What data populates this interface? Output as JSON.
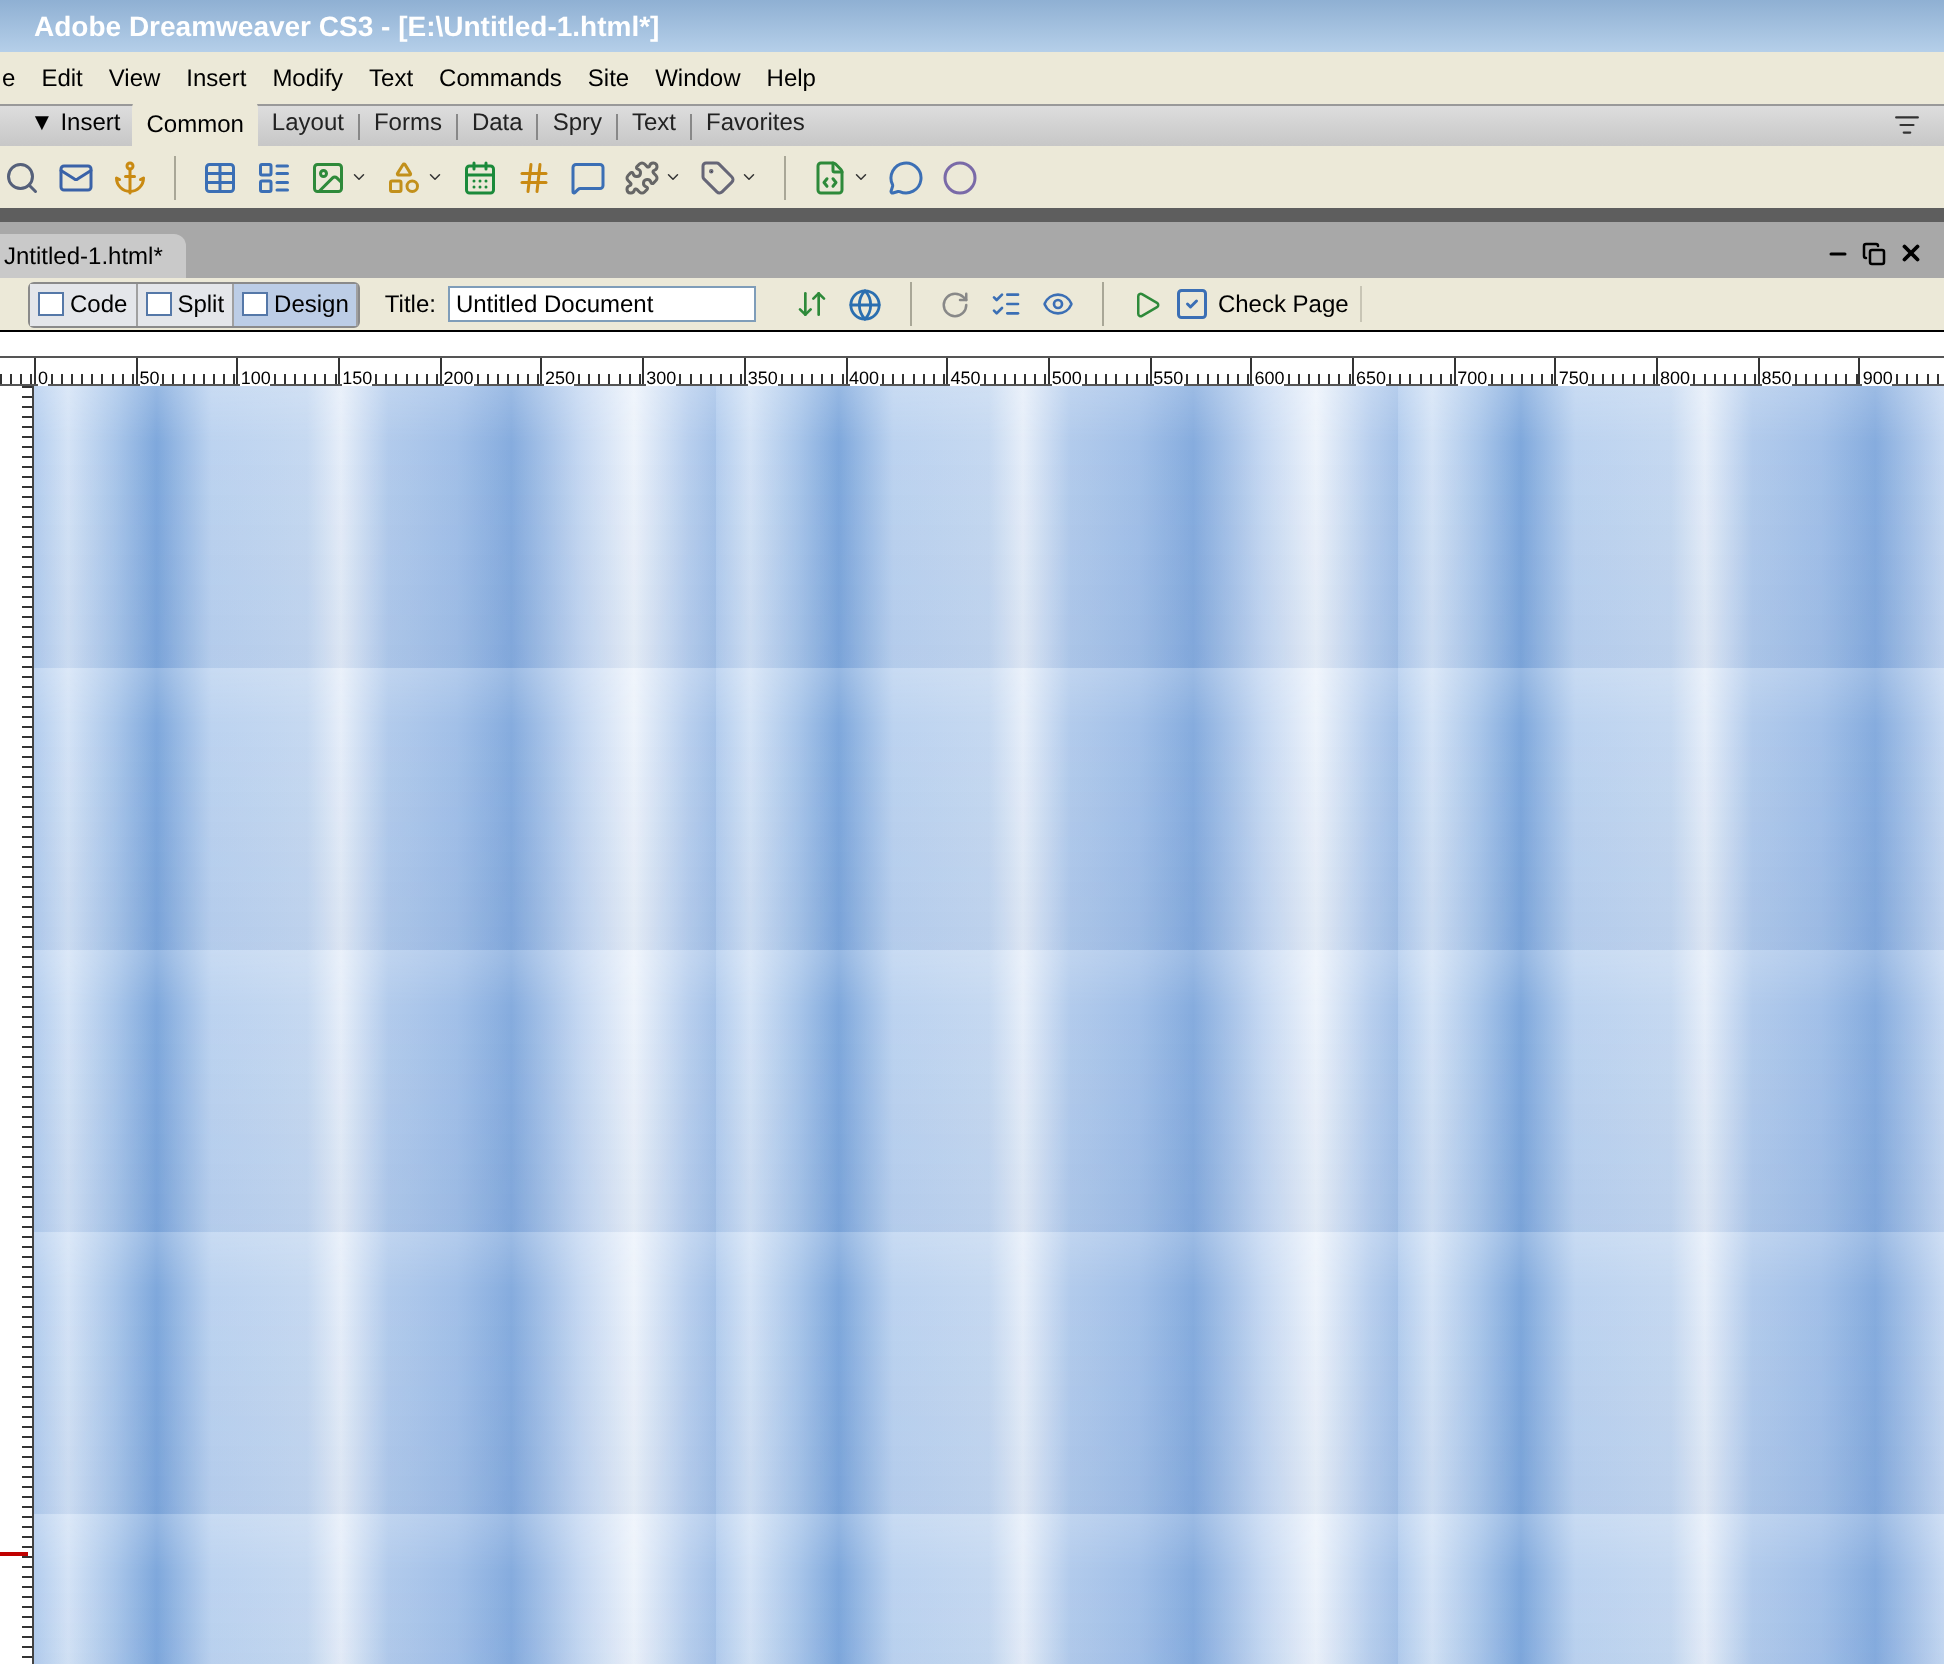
{
  "window": {
    "title": "Adobe Dreamweaver CS3 - [E:\\Untitled-1.html*]"
  },
  "menu": [
    "e",
    "Edit",
    "View",
    "Insert",
    "Modify",
    "Text",
    "Commands",
    "Site",
    "Window",
    "Help"
  ],
  "insert_bar": {
    "label": "▼ Insert",
    "tabs": [
      {
        "label": "Common",
        "selected": true
      },
      {
        "label": "Layout",
        "selected": false
      },
      {
        "label": "Forms",
        "selected": false
      },
      {
        "label": "Data",
        "selected": false
      },
      {
        "label": "Spry",
        "selected": false
      },
      {
        "label": "Text",
        "selected": false
      },
      {
        "label": "Favorites",
        "selected": false
      }
    ]
  },
  "document": {
    "tab_label": "Jntitled-1.html*",
    "view_buttons": [
      {
        "label": "Code",
        "selected": false
      },
      {
        "label": "Split",
        "selected": false
      },
      {
        "label": "Design",
        "selected": true
      }
    ],
    "title_label": "Title:",
    "title_value": "Untitled Document",
    "check_page": "Check Page"
  },
  "ruler": [
    "0",
    "50",
    "100",
    "150",
    "200",
    "250",
    "300",
    "350",
    "400",
    "450",
    "500",
    "550",
    "600",
    "650",
    "700",
    "750",
    "800",
    "850",
    "900"
  ]
}
